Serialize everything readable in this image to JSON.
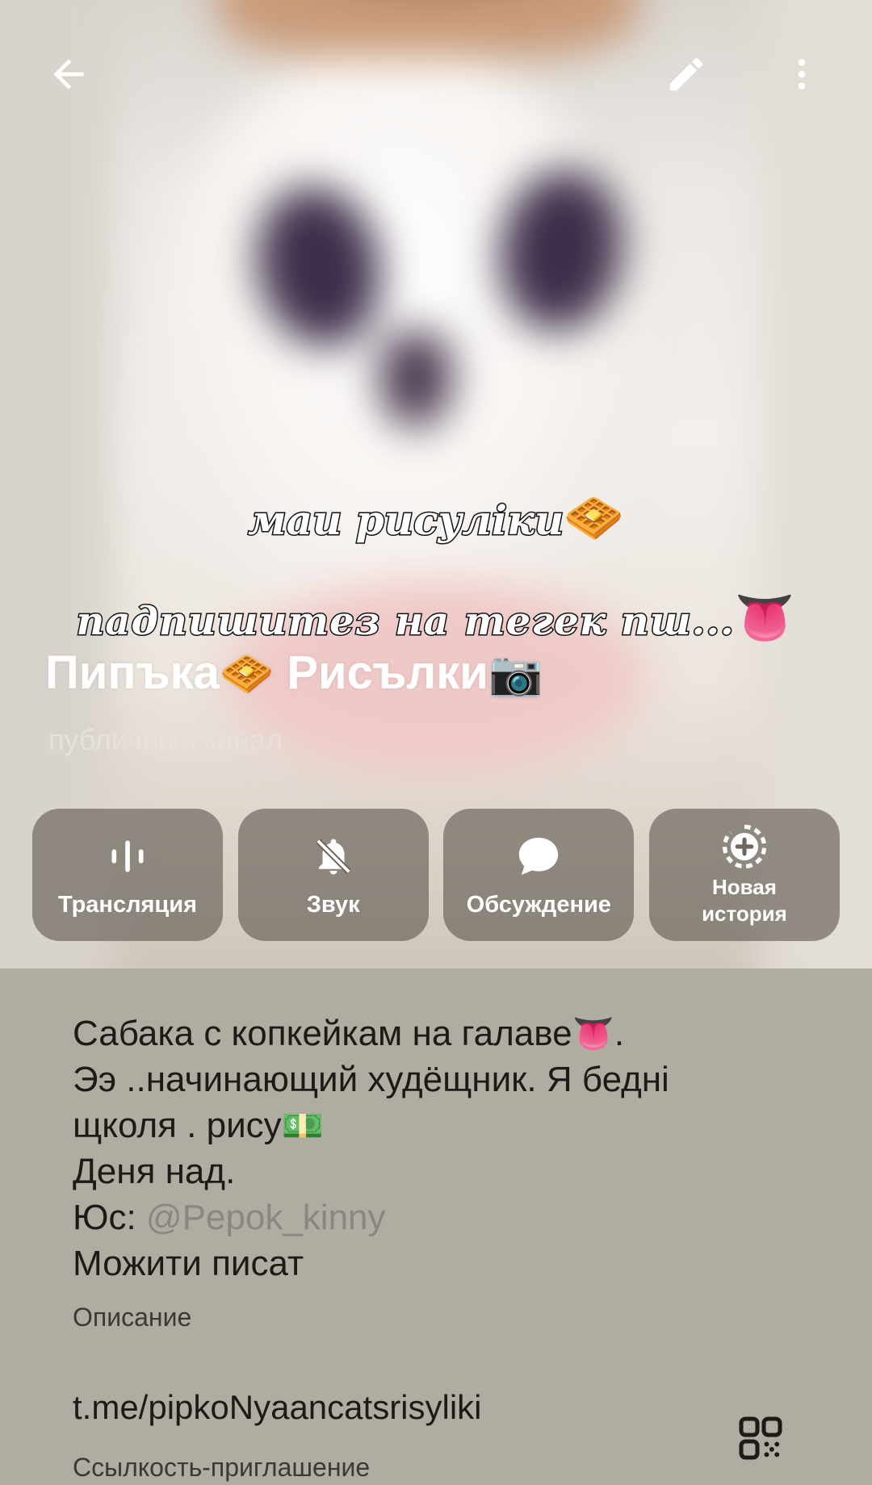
{
  "toolbar": {
    "back_icon": "arrow-left-icon",
    "edit_icon": "pencil-icon",
    "more_icon": "more-vertical-icon"
  },
  "overlay": {
    "line1": "маи рисуліки",
    "line1_emoji": "🧇",
    "line2": "падпишитез на тегек пш...",
    "line2_emoji": "👅"
  },
  "channel": {
    "name_part1": "Пипъка",
    "name_emoji1": "🧇",
    "name_part2": " Рисълки",
    "name_emoji2": "📷",
    "type": "публичный канал"
  },
  "actions": [
    {
      "label": "Трансляция",
      "icon": "broadcast-icon"
    },
    {
      "label": "Звук",
      "icon": "bell-off-icon"
    },
    {
      "label": "Обсуждение",
      "icon": "chat-bubble-icon"
    },
    {
      "label": "Новая история",
      "icon": "new-story-icon"
    }
  ],
  "info": {
    "description": {
      "line1": "Сабака с копкейкам на галаве",
      "line1_emoji": "👅",
      "line1_end": ".",
      "line2": "Ээ ..начинающий худёщник. Я бедні",
      "line3": "щколя . рису",
      "line3_emoji": "💵",
      "line4": "Деня над.",
      "line5_prefix": "Юс: ",
      "line5_mention": "@Pepok_kinny",
      "line6": "Можити писат"
    },
    "description_label": "Описание",
    "invite_link": "t.me/pipkoNyaancatsrisyliki",
    "invite_label": "Ссылкость-приглашение",
    "qr_icon": "qr-code-icon"
  },
  "colors": {
    "info_bg": "#b1aca1",
    "button_bg": "#605850",
    "mention": "#8a877f",
    "text_dark": "#1d1b19"
  }
}
